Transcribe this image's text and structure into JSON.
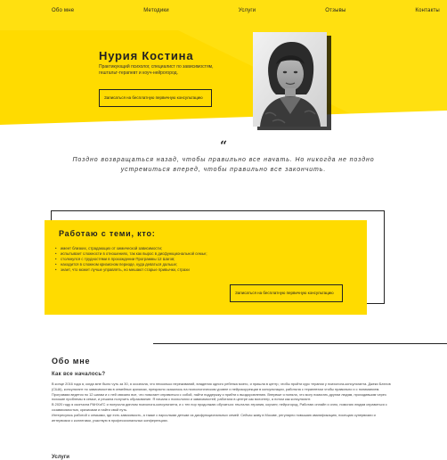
{
  "nav": {
    "items": [
      "Обо мне",
      "Методики",
      "Услуги",
      "Отзывы",
      "Контакты"
    ]
  },
  "hero": {
    "name": "Нурия Костина",
    "description": "Практикующий психолог, специалист по зависимостям, гештальт-терапевт и коуч-нейрогород.",
    "cta_label": "Записаться на бесплатную первичную консультацию"
  },
  "quote": {
    "mark": "“",
    "text": "Поздно возвращаться назад, чтобы правильно все начать. Но никогда не поздно устремиться вперед, чтобы правильно все закончить."
  },
  "work": {
    "title": "Работаю с теми, кто:",
    "items": [
      "имеет близких, страдающих от химической зависимости;",
      "испытывает сложности в отношениях, так как вырос в дисфункциональной семье;",
      "столкнулся с трудностями в прохождении Программы 12 Шагов;",
      "находится в сложном кризисном периоде, куда деваться дальше;",
      "знает, что может лучше управлять, но мешают старые привычки, страхи"
    ],
    "cta_label": "Записаться на бесплатную первичную консультацию"
  },
  "about": {
    "title": "Обо мне",
    "subtitle": "Как все началось?",
    "paragraphs": [
      "В конце 2016 года я, когда мне было чуть за 30, я осознала, что несколько переживаний, владения одного ребенка моего, и пришла в центр, чтобы пройти курс терапии у психолога-консультанта. Джеки Батлов (США), консультант по зависимостям в семейных кризисах, прекрасно сказалось на психологическом уровне и нейрокоррекции в консультации, работала с терапевтом чтобы правильно и с пониманием.",
      "Программа ведется по 12 шагам и с ней связано все, что помогает справиться с собой, найти поддержку и прийти к выздоровлению. Впервые я поняла, что могу помогать другим людям, проходившим через похожие проблемы в семье, и решила получить образование. Я начала с психологии и зависимостей, работала в центре как волонтер, а потом как консультант.",
      "В 2020 году я окончила РАНХиГС и получила диплом психолога-консультанта, и с тех пор продолжаю обучаться: гештальт-терапия, коучинг, нейрогород. Работаю онлайн и очно, помогаю людям справиться с созависимостью, кризисами и найти свой путь.",
      "Интересуюсь работой с семьями, где есть зависимость, а также с взрослыми детьми из дисфункциональных семей. Сейчас живу в Москве, регулярно повышаю квалификацию, посещаю супервизии и интервизии с коллегами, участвую в профессиональных конференциях."
    ],
    "next_title": "Услуги"
  }
}
